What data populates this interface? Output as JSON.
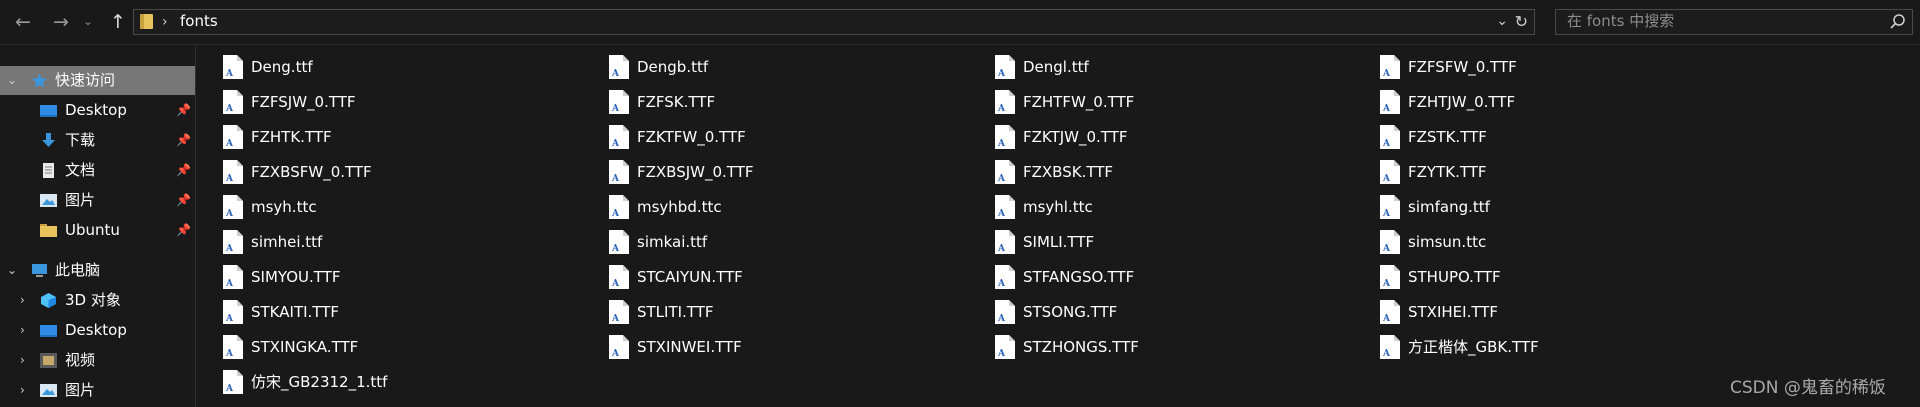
{
  "nav": {
    "back_icon": "back-arrow",
    "forward_icon": "forward-arrow",
    "recent_icon": "chevron-down",
    "up_icon": "up-arrow"
  },
  "address": {
    "path": "fonts",
    "separator": "›"
  },
  "search": {
    "placeholder": "在 fonts 中搜索"
  },
  "sidebar": {
    "quick_access": {
      "label": "快速访问"
    },
    "quick_items": [
      {
        "label": "Desktop",
        "icon": "desktop-icon"
      },
      {
        "label": "下载",
        "icon": "download-icon"
      },
      {
        "label": "文档",
        "icon": "document-icon"
      },
      {
        "label": "图片",
        "icon": "pictures-icon"
      },
      {
        "label": "Ubuntu",
        "icon": "folder-icon"
      }
    ],
    "this_pc": {
      "label": "此电脑"
    },
    "pc_items": [
      {
        "label": "3D 对象",
        "icon": "3d-objects-icon"
      },
      {
        "label": "Desktop",
        "icon": "desktop-icon"
      },
      {
        "label": "视频",
        "icon": "video-icon"
      },
      {
        "label": "图片",
        "icon": "pictures-icon"
      }
    ]
  },
  "files": [
    "Deng.ttf",
    "Dengb.ttf",
    "Dengl.ttf",
    "FZFSFW_0.TTF",
    "FZFSJW_0.TTF",
    "FZFSK.TTF",
    "FZHTFW_0.TTF",
    "FZHTJW_0.TTF",
    "FZHTK.TTF",
    "FZKTFW_0.TTF",
    "FZKTJW_0.TTF",
    "FZSTK.TTF",
    "FZXBSFW_0.TTF",
    "FZXBSJW_0.TTF",
    "FZXBSK.TTF",
    "FZYTK.TTF",
    "msyh.ttc",
    "msyhbd.ttc",
    "msyhl.ttc",
    "simfang.ttf",
    "simhei.ttf",
    "simkai.ttf",
    "SIMLI.TTF",
    "simsun.ttc",
    "SIMYOU.TTF",
    "STCAIYUN.TTF",
    "STFANGSO.TTF",
    "STHUPO.TTF",
    "STKAITI.TTF",
    "STLITI.TTF",
    "STSONG.TTF",
    "STXIHEI.TTF",
    "STXINGKA.TTF",
    "STXINWEI.TTF",
    "STZHONGS.TTF",
    "方正楷体_GBK.TTF",
    "仿宋_GB2312_1.ttf"
  ],
  "watermark": "CSDN @鬼畜的稀饭",
  "colors": {
    "background": "#191919",
    "selected": "#777777",
    "text": "#ffffff",
    "star": "#3a96dd",
    "folder": "#e8c25a"
  }
}
